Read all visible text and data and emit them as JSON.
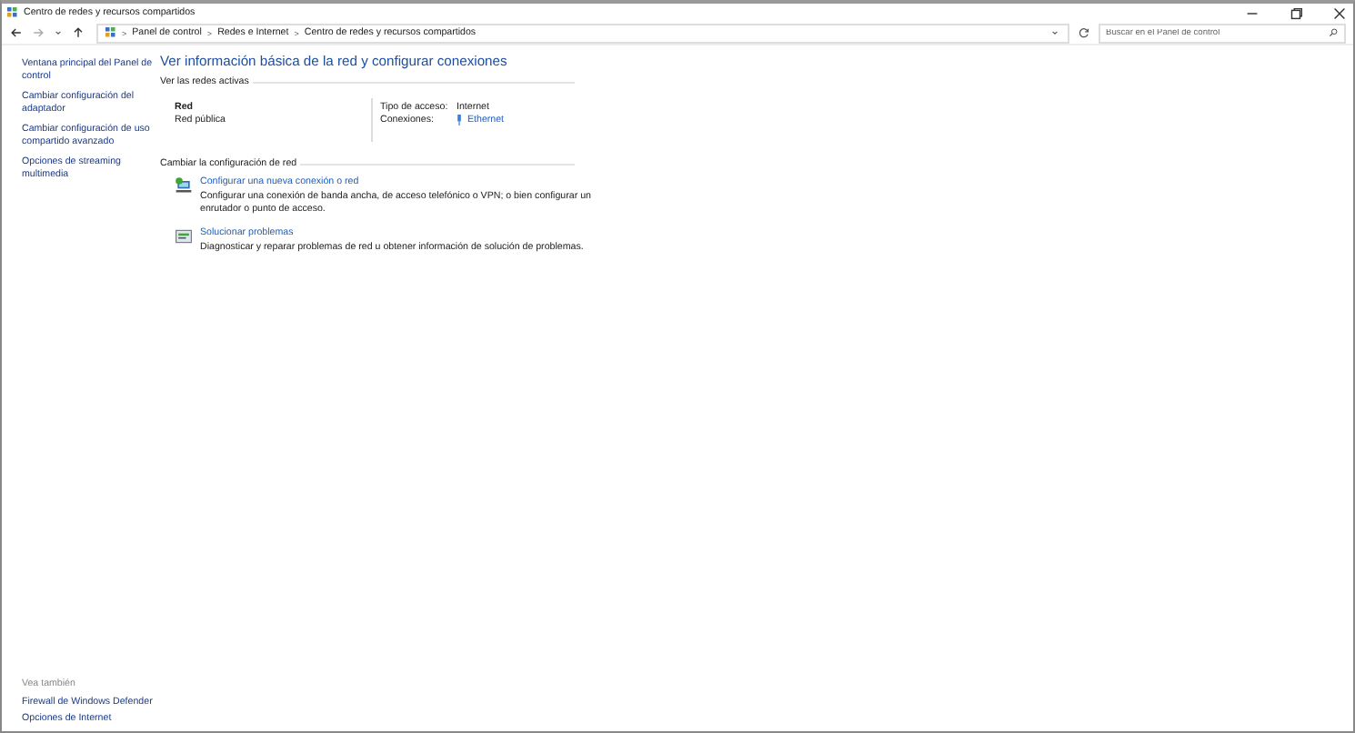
{
  "window": {
    "title": "Centro de redes y recursos compartidos"
  },
  "address_bar": {
    "breadcrumbs": [
      "Panel de control",
      "Redes e Internet",
      "Centro de redes y recursos compartidos"
    ],
    "separator": ">"
  },
  "search": {
    "placeholder": "Buscar en el Panel de control"
  },
  "sidebar": {
    "items": [
      {
        "label": "Ventana principal del Panel de control"
      },
      {
        "label": "Cambiar configuración del adaptador"
      },
      {
        "label": "Cambiar configuración de uso compartido avanzado"
      },
      {
        "label": "Opciones de streaming multimedia"
      }
    ],
    "see_also": {
      "heading": "Vea también",
      "links": [
        "Firewall de Windows Defender",
        "Opciones de Internet"
      ]
    }
  },
  "main": {
    "heading": "Ver información básica de la red y configurar conexiones",
    "active_networks": {
      "heading": "Ver las redes activas",
      "name": "Red",
      "category": "Red pública",
      "access_label": "Tipo de acceso:",
      "access_value": "Internet",
      "connections_label": "Conexiones:",
      "connections_value": "Ethernet"
    },
    "change_settings": {
      "heading": "Cambiar la configuración de red",
      "items": [
        {
          "kind": "network",
          "link": "Configurar una nueva conexión o red",
          "description": "Configurar una conexión de banda ancha, de acceso telefónico o VPN; o bien configurar un enrutador o punto de acceso."
        },
        {
          "kind": "troubleshoot",
          "link": "Solucionar problemas",
          "description": "Diagnosticar y reparar problemas de red u obtener información de solución de problemas."
        }
      ]
    }
  }
}
